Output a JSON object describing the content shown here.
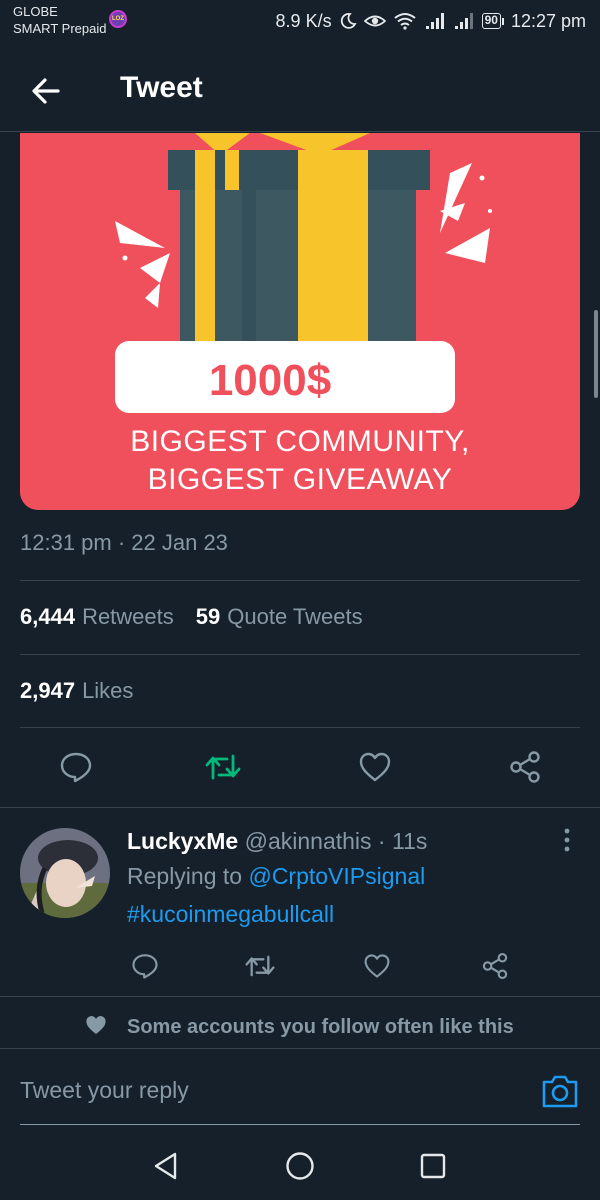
{
  "status_bar": {
    "carrier_line1": "GLOBE",
    "carrier_line2": "SMART Prepaid",
    "carrier_badge": "LOZ",
    "net_speed": "8.9 K/s",
    "battery": "90",
    "time": "12:27 pm"
  },
  "header": {
    "title": "Tweet"
  },
  "tweet": {
    "image": {
      "amount": "1000$",
      "line1": "BIGGEST COMMUNITY,",
      "line2": "BIGGEST GIVEAWAY"
    },
    "timestamp": "12:31 pm · 22 Jan 23",
    "retweets_count": "6,444",
    "retweets_label": "Retweets",
    "quotes_count": "59",
    "quotes_label": "Quote Tweets",
    "likes_count": "2,947",
    "likes_label": "Likes",
    "retweet_color": "#00ba7c"
  },
  "reply": {
    "name": "LuckyxMe",
    "handle": "@akinnathis",
    "time": "11s",
    "replying_prefix": "Replying to",
    "replying_to": "@CrptoVIPsignal",
    "text": "#kucoinmegabullcall"
  },
  "social_context": "Some accounts you follow often like this Tweet",
  "composer": {
    "placeholder": "Tweet your reply"
  },
  "colors": {
    "background": "#15202b",
    "accent": "#1d9bf0",
    "muted": "#8899a6",
    "border": "#38444d",
    "media_bg": "#f0505c"
  },
  "icons": [
    "back-arrow-icon",
    "reply-icon",
    "retweet-icon",
    "like-icon",
    "share-icon",
    "more-icon",
    "camera-icon",
    "nav-back-icon",
    "nav-home-icon",
    "nav-recents-icon"
  ]
}
